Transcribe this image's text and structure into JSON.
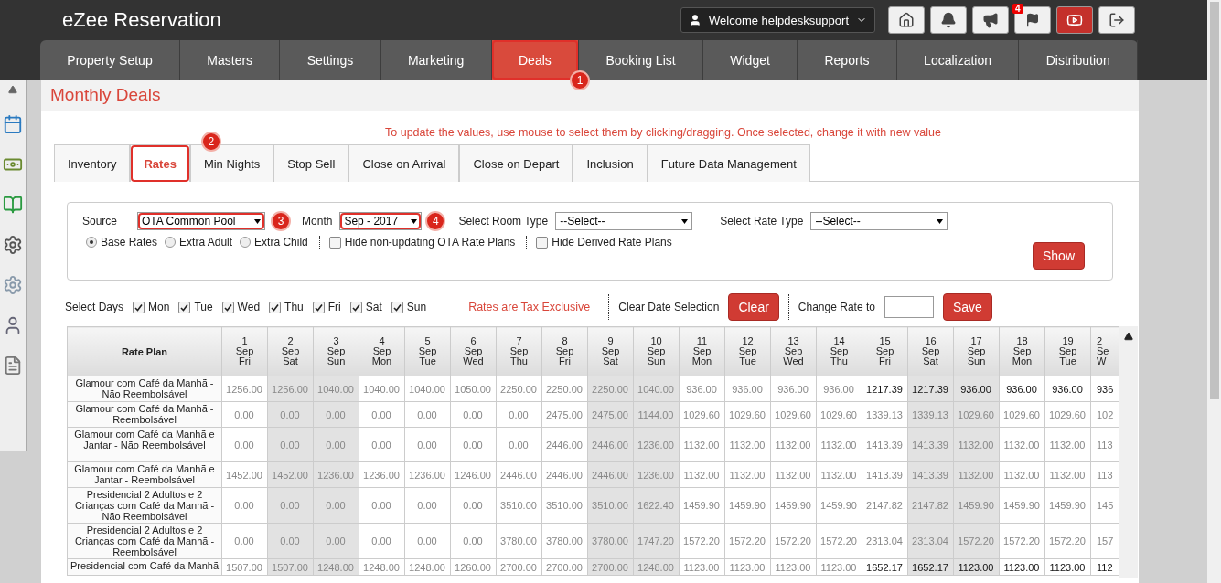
{
  "app": {
    "title": "eZee Reservation",
    "user": "Welcome helpdesksupport",
    "notification_count": "4"
  },
  "nav": [
    {
      "label": "Property Setup",
      "selected": false
    },
    {
      "label": "Masters",
      "selected": false
    },
    {
      "label": "Settings",
      "selected": false
    },
    {
      "label": "Marketing",
      "selected": false
    },
    {
      "label": "Deals",
      "selected": true,
      "callout": "1"
    },
    {
      "label": "Booking List",
      "selected": false
    },
    {
      "label": "Widget",
      "selected": false
    },
    {
      "label": "Reports",
      "selected": false
    },
    {
      "label": "Localization",
      "selected": false
    },
    {
      "label": "Distribution",
      "selected": false
    }
  ],
  "page": {
    "title": "Monthly Deals",
    "note": "To update the values, use mouse to select them by clicking/dragging. Once selected, change it with new value"
  },
  "tabs": [
    {
      "label": "Inventory",
      "selected": false
    },
    {
      "label": "Rates",
      "selected": true,
      "callout": "2"
    },
    {
      "label": "Min Nights",
      "selected": false
    },
    {
      "label": "Stop Sell",
      "selected": false
    },
    {
      "label": "Close on Arrival",
      "selected": false
    },
    {
      "label": "Close on Depart",
      "selected": false
    },
    {
      "label": "Inclusion",
      "selected": false
    },
    {
      "label": "Future Data Management",
      "selected": false
    }
  ],
  "filters": {
    "source": {
      "label": "Source",
      "value": "OTA Common Pool",
      "callout": "3"
    },
    "month": {
      "label": "Month",
      "value": "Sep - 2017",
      "callout": "4"
    },
    "room_type": {
      "label": "Select Room Type",
      "value": "--Select--"
    },
    "rate_type": {
      "label": "Select Rate Type",
      "value": "--Select--"
    },
    "rate_options": [
      {
        "label": "Base Rates",
        "selected": true
      },
      {
        "label": "Extra Adult",
        "selected": false
      },
      {
        "label": "Extra Child",
        "selected": false
      }
    ],
    "hide_options": [
      {
        "label": "Hide non-updating OTA Rate Plans",
        "checked": false
      },
      {
        "label": "Hide Derived Rate Plans",
        "checked": false
      }
    ],
    "show_button": "Show"
  },
  "days": {
    "label": "Select Days",
    "items": [
      {
        "label": "Mon",
        "checked": true
      },
      {
        "label": "Tue",
        "checked": true
      },
      {
        "label": "Wed",
        "checked": true
      },
      {
        "label": "Thu",
        "checked": true
      },
      {
        "label": "Fri",
        "checked": true
      },
      {
        "label": "Sat",
        "checked": true
      },
      {
        "label": "Sun",
        "checked": true
      }
    ]
  },
  "tax_note": "Rates are Tax Exclusive",
  "clear_label": "Clear Date Selection",
  "clear_button": "Clear",
  "change_rate_label": "Change Rate to",
  "save_button": "Save",
  "table": {
    "first_column": "Rate Plan",
    "columns": [
      {
        "day": "1",
        "month": "Sep",
        "weekday": "Fri",
        "weekend": false
      },
      {
        "day": "2",
        "month": "Sep",
        "weekday": "Sat",
        "weekend": true
      },
      {
        "day": "3",
        "month": "Sep",
        "weekday": "Sun",
        "weekend": true
      },
      {
        "day": "4",
        "month": "Sep",
        "weekday": "Mon",
        "weekend": false
      },
      {
        "day": "5",
        "month": "Sep",
        "weekday": "Tue",
        "weekend": false
      },
      {
        "day": "6",
        "month": "Sep",
        "weekday": "Wed",
        "weekend": false
      },
      {
        "day": "7",
        "month": "Sep",
        "weekday": "Thu",
        "weekend": false
      },
      {
        "day": "8",
        "month": "Sep",
        "weekday": "Fri",
        "weekend": false
      },
      {
        "day": "9",
        "month": "Sep",
        "weekday": "Sat",
        "weekend": true
      },
      {
        "day": "10",
        "month": "Sep",
        "weekday": "Sun",
        "weekend": true
      },
      {
        "day": "11",
        "month": "Sep",
        "weekday": "Mon",
        "weekend": false
      },
      {
        "day": "12",
        "month": "Sep",
        "weekday": "Tue",
        "weekend": false
      },
      {
        "day": "13",
        "month": "Sep",
        "weekday": "Wed",
        "weekend": false
      },
      {
        "day": "14",
        "month": "Sep",
        "weekday": "Thu",
        "weekend": false
      },
      {
        "day": "15",
        "month": "Sep",
        "weekday": "Fri",
        "weekend": false
      },
      {
        "day": "16",
        "month": "Sep",
        "weekday": "Sat",
        "weekend": true
      },
      {
        "day": "17",
        "month": "Sep",
        "weekday": "Sun",
        "weekend": true
      },
      {
        "day": "18",
        "month": "Sep",
        "weekday": "Mon",
        "weekend": false
      },
      {
        "day": "19",
        "month": "Sep",
        "weekday": "Tue",
        "weekend": false
      },
      {
        "day": "2",
        "month": "Se",
        "weekday": "W",
        "weekend": false
      }
    ],
    "rows": [
      {
        "plan": "Glamour com Café da Manhã - Não Reembolsável",
        "values": [
          "1256.00",
          "1256.00",
          "1040.00",
          "1040.00",
          "1040.00",
          "1050.00",
          "2250.00",
          "2250.00",
          "2250.00",
          "1040.00",
          "936.00",
          "936.00",
          "936.00",
          "936.00",
          "1217.39",
          "1217.39",
          "936.00",
          "936.00",
          "936.00",
          "936"
        ],
        "emphasized": [
          false,
          false,
          false,
          false,
          false,
          false,
          false,
          false,
          false,
          false,
          false,
          false,
          false,
          false,
          true,
          true,
          true,
          true,
          true,
          true
        ]
      },
      {
        "plan": "Glamour com Café da Manhã - Reembolsável",
        "values": [
          "0.00",
          "0.00",
          "0.00",
          "0.00",
          "0.00",
          "0.00",
          "0.00",
          "2475.00",
          "2475.00",
          "1144.00",
          "1029.60",
          "1029.60",
          "1029.60",
          "1029.60",
          "1339.13",
          "1339.13",
          "1029.60",
          "1029.60",
          "1029.60",
          "102"
        ],
        "emphasized": [
          false,
          false,
          false,
          false,
          false,
          false,
          false,
          false,
          false,
          false,
          false,
          false,
          false,
          false,
          false,
          false,
          false,
          false,
          false,
          false
        ]
      },
      {
        "plan": "Glamour com Café da Manhã e Jantar - Não Reembolsável",
        "values": [
          "0.00",
          "0.00",
          "0.00",
          "0.00",
          "0.00",
          "0.00",
          "0.00",
          "2446.00",
          "2446.00",
          "1236.00",
          "1132.00",
          "1132.00",
          "1132.00",
          "1132.00",
          "1413.39",
          "1413.39",
          "1132.00",
          "1132.00",
          "1132.00",
          "113"
        ],
        "emphasized": [
          false,
          false,
          false,
          false,
          false,
          false,
          false,
          false,
          false,
          false,
          false,
          false,
          false,
          false,
          false,
          false,
          false,
          false,
          false,
          false
        ]
      },
      {
        "plan": "Glamour com Café da Manhã e Jantar - Reembolsável",
        "values": [
          "1452.00",
          "1452.00",
          "1236.00",
          "1236.00",
          "1236.00",
          "1246.00",
          "2446.00",
          "2446.00",
          "2446.00",
          "1236.00",
          "1132.00",
          "1132.00",
          "1132.00",
          "1132.00",
          "1413.39",
          "1413.39",
          "1132.00",
          "1132.00",
          "1132.00",
          "113"
        ],
        "emphasized": [
          false,
          false,
          false,
          false,
          false,
          false,
          false,
          false,
          false,
          false,
          false,
          false,
          false,
          false,
          false,
          false,
          false,
          false,
          false,
          false
        ]
      },
      {
        "plan": "Presidencial 2 Adultos e 2 Crianças com Café da Manhã - Não Reembolsável",
        "values": [
          "0.00",
          "0.00",
          "0.00",
          "0.00",
          "0.00",
          "0.00",
          "3510.00",
          "3510.00",
          "3510.00",
          "1622.40",
          "1459.90",
          "1459.90",
          "1459.90",
          "1459.90",
          "2147.82",
          "2147.82",
          "1459.90",
          "1459.90",
          "1459.90",
          "145"
        ],
        "emphasized": [
          false,
          false,
          false,
          false,
          false,
          false,
          false,
          false,
          false,
          false,
          false,
          false,
          false,
          false,
          false,
          false,
          false,
          false,
          false,
          false
        ]
      },
      {
        "plan": "Presidencial 2 Adultos e 2 Crianças com Café da Manhã - Reembolsável",
        "values": [
          "0.00",
          "0.00",
          "0.00",
          "0.00",
          "0.00",
          "0.00",
          "3780.00",
          "3780.00",
          "3780.00",
          "1747.20",
          "1572.20",
          "1572.20",
          "1572.20",
          "1572.20",
          "2313.04",
          "2313.04",
          "1572.20",
          "1572.20",
          "1572.20",
          "157"
        ],
        "emphasized": [
          false,
          false,
          false,
          false,
          false,
          false,
          false,
          false,
          false,
          false,
          false,
          false,
          false,
          false,
          false,
          false,
          false,
          false,
          false,
          false
        ]
      },
      {
        "plan": "Presidencial com Café da Manhã",
        "values": [
          "1507.00",
          "1507.00",
          "1248.00",
          "1248.00",
          "1248.00",
          "1260.00",
          "2700.00",
          "2700.00",
          "2700.00",
          "1248.00",
          "1123.00",
          "1123.00",
          "1123.00",
          "1123.00",
          "1652.17",
          "1652.17",
          "1123.00",
          "1123.00",
          "1123.00",
          "112"
        ],
        "emphasized": [
          false,
          false,
          false,
          false,
          false,
          false,
          false,
          false,
          false,
          false,
          false,
          false,
          false,
          false,
          true,
          true,
          true,
          true,
          true,
          true
        ]
      }
    ]
  }
}
